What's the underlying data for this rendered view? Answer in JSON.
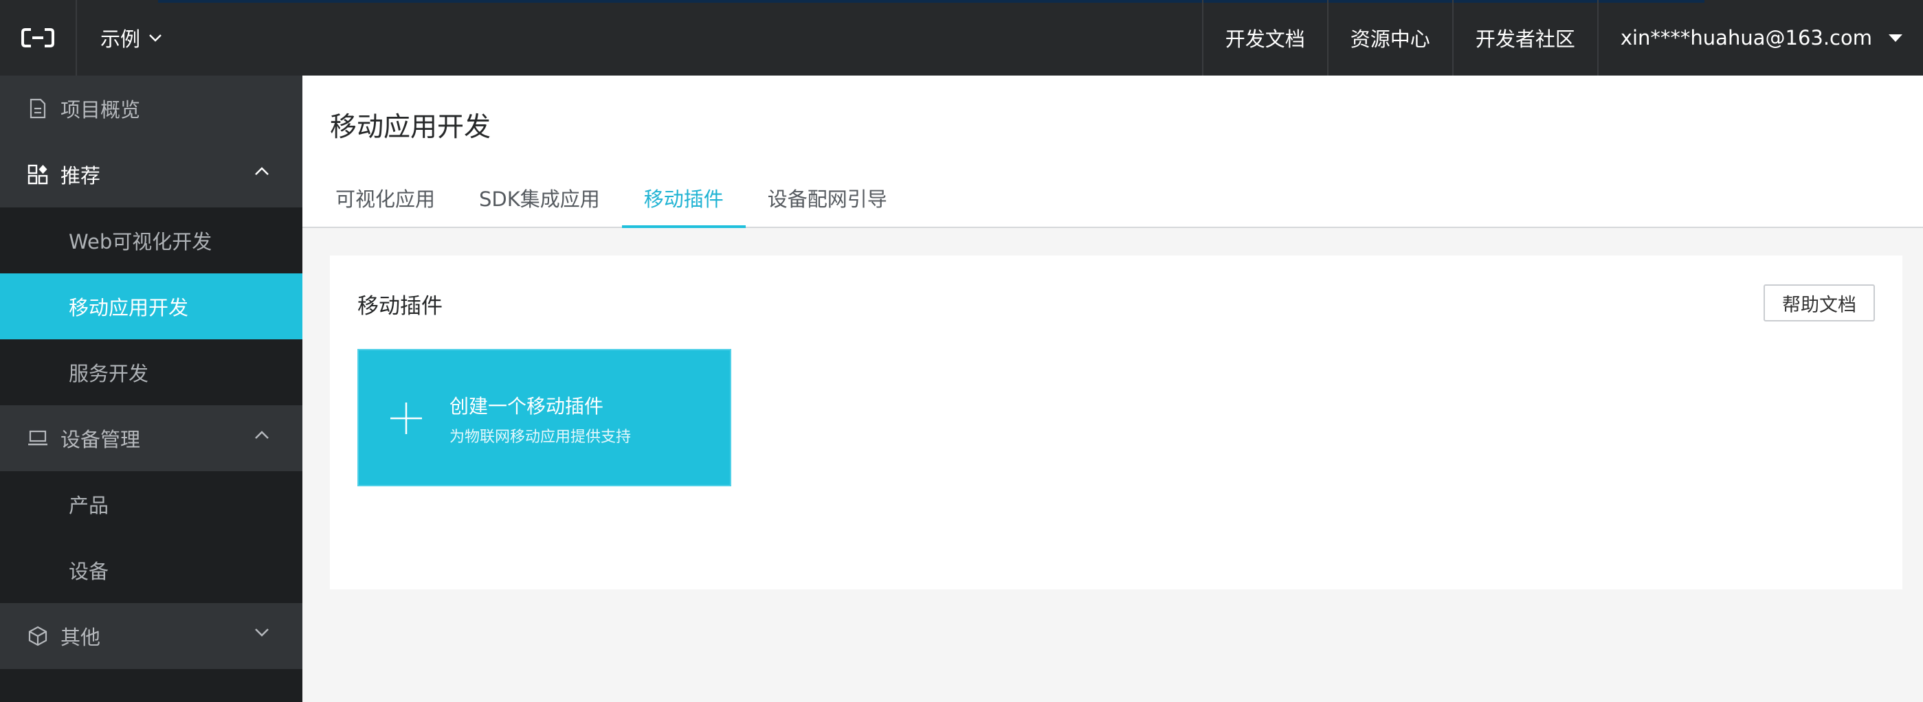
{
  "topbar": {
    "logo_icon": "aliyun-logo-icon",
    "project": "示例",
    "nav": [
      "开发文档",
      "资源中心",
      "开发者社区"
    ],
    "user": "xin****huahua@163.com"
  },
  "sidebar": {
    "overview": "项目概览",
    "groups": [
      {
        "label": "推荐",
        "icon": "grid-icon",
        "items": [
          "Web可视化开发",
          "移动应用开发",
          "服务开发"
        ],
        "expanded": true
      },
      {
        "label": "设备管理",
        "icon": "laptop-icon",
        "items": [
          "产品",
          "设备"
        ],
        "expanded": true
      },
      {
        "label": "其他",
        "icon": "cube-icon",
        "items": [],
        "expanded": false
      }
    ],
    "selected_item": "移动应用开发"
  },
  "main": {
    "title": "移动应用开发",
    "tabs": [
      "可视化应用",
      "SDK集成应用",
      "移动插件",
      "设备配网引导"
    ],
    "active_tab": "移动插件",
    "card": {
      "title": "移动插件",
      "help_button": "帮助文档",
      "create": {
        "title": "创建一个移动插件",
        "subtitle": "为物联网移动应用提供支持"
      }
    }
  },
  "colors": {
    "accent": "#20c0dc",
    "topbar_bg": "#27292b",
    "sidebar_bg": "#1d1f21",
    "sidebar_group_bg": "#323538"
  }
}
